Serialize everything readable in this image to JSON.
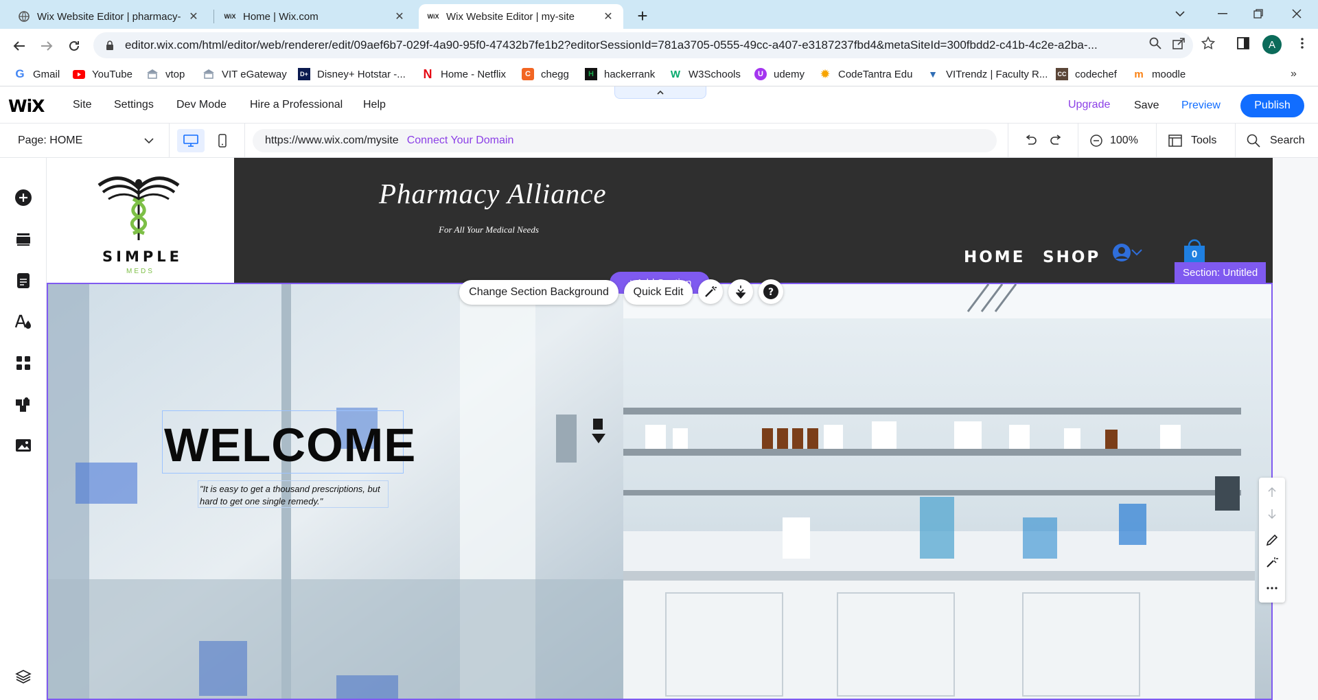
{
  "browser": {
    "tabs": [
      {
        "title": "Wix Website Editor | pharmacy-a",
        "favicon": "globe-icon"
      },
      {
        "title": "Home | Wix.com",
        "favicon": "wix-icon"
      },
      {
        "title": "Wix Website Editor | my-site",
        "favicon": "wix-icon",
        "active": true
      }
    ],
    "url": "editor.wix.com/html/editor/web/renderer/edit/09aef6b7-029f-4a90-95f0-47432b7fe1b2?editorSessionId=781a3705-0555-49cc-a407-e3187237fbd4&metaSiteId=300fbdd2-c41b-4c2e-a2ba-...",
    "profile_initial": "A",
    "bookmarks": [
      {
        "label": "Gmail",
        "icon": "google-icon",
        "color": "#4285f4"
      },
      {
        "label": "YouTube",
        "icon": "youtube-icon",
        "color": "#ff0000"
      },
      {
        "label": "vtop",
        "icon": "vtop-icon",
        "color": "#6b7c93"
      },
      {
        "label": "VIT eGateway",
        "icon": "vit-icon",
        "color": "#6b7c93"
      },
      {
        "label": "Disney+ Hotstar -...",
        "icon": "hotstar-icon",
        "color": "#0b1a50"
      },
      {
        "label": "Home - Netflix",
        "icon": "netflix-icon",
        "color": "#e50914"
      },
      {
        "label": "chegg",
        "icon": "chegg-icon",
        "color": "#f26522"
      },
      {
        "label": "hackerrank",
        "icon": "hackerrank-icon",
        "color": "#1ba94c"
      },
      {
        "label": "W3Schools",
        "icon": "w3schools-icon",
        "color": "#04aa6d"
      },
      {
        "label": "udemy",
        "icon": "udemy-icon",
        "color": "#a435f0"
      },
      {
        "label": "CodeTantra Edu",
        "icon": "codetantra-icon",
        "color": "#f7a400"
      },
      {
        "label": "VITrendz | Faculty R...",
        "icon": "vitrendz-icon",
        "color": "#2f6db5"
      },
      {
        "label": "codechef",
        "icon": "codechef-icon",
        "color": "#5b4638"
      },
      {
        "label": "moodle",
        "icon": "moodle-icon",
        "color": "#f98012"
      }
    ]
  },
  "wix": {
    "logo": "WiX",
    "menu": [
      "Site",
      "Settings",
      "Dev Mode",
      "Hire a Professional",
      "Help"
    ],
    "upgrade": "Upgrade",
    "save": "Save",
    "preview": "Preview",
    "publish": "Publish",
    "page_select": "Page: HOME",
    "site_url": "https://www.wix.com/mysite",
    "connect_domain": "Connect Your Domain",
    "zoom": "100%",
    "tools": "Tools",
    "search": "Search",
    "accent": "#116dff",
    "section_accent": "#7f5af0"
  },
  "site": {
    "logo_word": "SIMPLE",
    "logo_sub": "MEDS",
    "title": "Pharmacy Alliance",
    "tagline": "For All Your Medical Needs",
    "nav": [
      "HOME",
      "SHOP"
    ],
    "cart_count": "0",
    "hero_heading": "WELCOME",
    "hero_quote": "\"It is easy to get a thousand prescriptions, but hard to get one single remedy.\""
  },
  "editor_overlay": {
    "section_label": "Section: Untitled",
    "add_section": "+ Add Section",
    "change_background": "Change Section Background",
    "quick_edit": "Quick Edit"
  }
}
